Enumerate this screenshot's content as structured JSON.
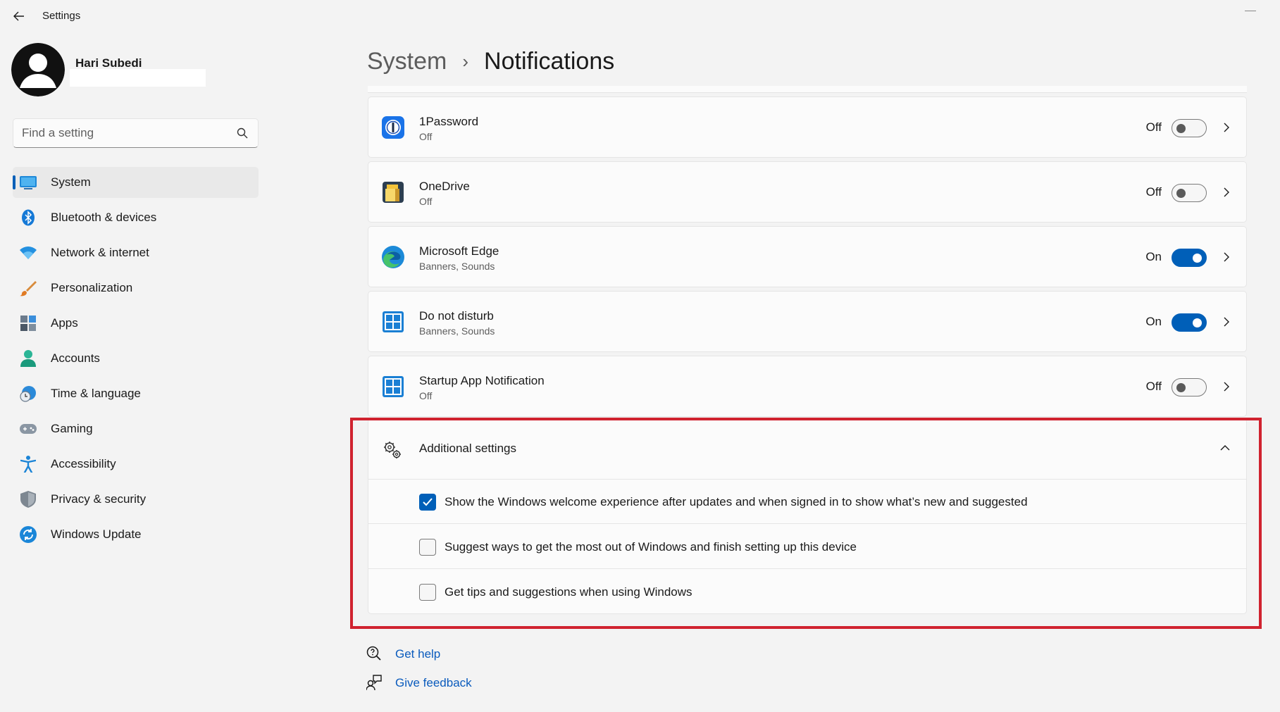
{
  "window": {
    "title": "Settings"
  },
  "profile": {
    "name": "Hari Subedi"
  },
  "search": {
    "placeholder": "Find a setting"
  },
  "sidebar": {
    "items": [
      {
        "label": "System",
        "icon": "system-icon",
        "active": true
      },
      {
        "label": "Bluetooth & devices",
        "icon": "bluetooth-icon"
      },
      {
        "label": "Network & internet",
        "icon": "wifi-icon"
      },
      {
        "label": "Personalization",
        "icon": "brush-icon"
      },
      {
        "label": "Apps",
        "icon": "apps-icon"
      },
      {
        "label": "Accounts",
        "icon": "person-icon"
      },
      {
        "label": "Time & language",
        "icon": "clock-globe-icon"
      },
      {
        "label": "Gaming",
        "icon": "controller-icon"
      },
      {
        "label": "Accessibility",
        "icon": "accessibility-icon"
      },
      {
        "label": "Privacy & security",
        "icon": "shield-icon"
      },
      {
        "label": "Windows Update",
        "icon": "update-icon"
      }
    ]
  },
  "breadcrumb": {
    "parent": "System",
    "separator": "›",
    "current": "Notifications"
  },
  "apps": [
    {
      "name": "1Password",
      "sub": "Off",
      "state": "Off",
      "on": false,
      "icon": "1password-icon"
    },
    {
      "name": "OneDrive",
      "sub": "Off",
      "state": "Off",
      "on": false,
      "icon": "onedrive-icon"
    },
    {
      "name": "Microsoft Edge",
      "sub": "Banners, Sounds",
      "state": "On",
      "on": true,
      "icon": "edge-icon"
    },
    {
      "name": "Do not disturb",
      "sub": "Banners, Sounds",
      "state": "On",
      "on": true,
      "icon": "app-tile-icon"
    },
    {
      "name": "Startup App Notification",
      "sub": "Off",
      "state": "Off",
      "on": false,
      "icon": "app-tile-icon"
    }
  ],
  "additional": {
    "title": "Additional settings",
    "options": [
      {
        "label": "Show the Windows welcome experience after updates and when signed in to show what’s new and suggested",
        "checked": true
      },
      {
        "label": "Suggest ways to get the most out of Windows and finish setting up this device",
        "checked": false
      },
      {
        "label": "Get tips and suggestions when using Windows",
        "checked": false
      }
    ]
  },
  "footer": {
    "help": "Get help",
    "feedback": "Give feedback"
  },
  "colors": {
    "accent": "#005fb8",
    "highlight": "#d0222f",
    "link": "#0a5bbd"
  }
}
